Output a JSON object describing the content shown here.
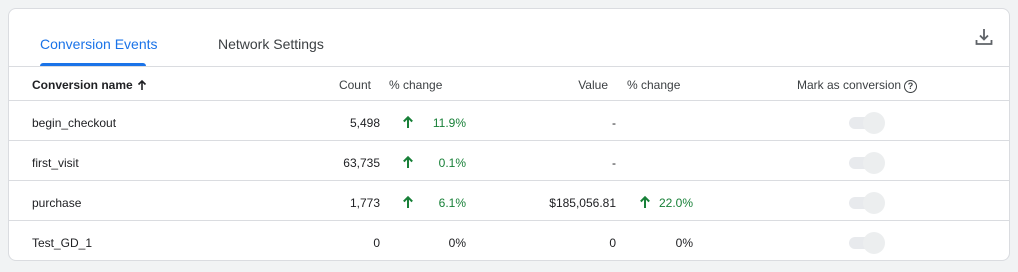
{
  "tabs": [
    {
      "label": "Conversion Events",
      "active": true
    },
    {
      "label": "Network Settings",
      "active": false
    }
  ],
  "columns": {
    "name": "Conversion name",
    "count": "Count",
    "count_change": "% change",
    "value": "Value",
    "value_change": "% change",
    "mark": "Mark as conversion"
  },
  "rows": [
    {
      "name": "begin_checkout",
      "count": "5,498",
      "count_change": "11.9%",
      "count_change_up": true,
      "value": "-",
      "value_change": "",
      "value_change_up": false,
      "marked": false
    },
    {
      "name": "first_visit",
      "count": "63,735",
      "count_change": "0.1%",
      "count_change_up": true,
      "value": "-",
      "value_change": "",
      "value_change_up": false,
      "marked": false
    },
    {
      "name": "purchase",
      "count": "1,773",
      "count_change": "6.1%",
      "count_change_up": true,
      "value": "$185,056.81",
      "value_change": "22.0%",
      "value_change_up": true,
      "marked": false
    },
    {
      "name": "Test_GD_1",
      "count": "0",
      "count_change": "0%",
      "count_change_up": false,
      "value": "0",
      "value_change": "0%",
      "value_change_up": false,
      "marked": false
    }
  ],
  "colors": {
    "accent": "#1a73e8",
    "positive": "#188038"
  },
  "icons": {
    "download": "download-icon",
    "sort": "arrow-upward-icon",
    "help": "help-icon",
    "trend": "arrow-up-icon"
  }
}
